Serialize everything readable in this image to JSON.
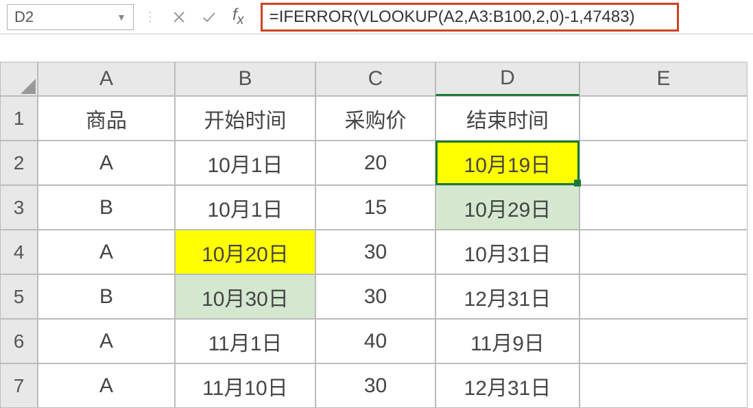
{
  "formula_bar": {
    "cell_reference": "D2",
    "formula": "=IFERROR(VLOOKUP(A2,A3:B100,2,0)-1,47483)"
  },
  "columns": [
    "A",
    "B",
    "C",
    "D",
    "E"
  ],
  "row_numbers": [
    "1",
    "2",
    "3",
    "4",
    "5",
    "6",
    "7"
  ],
  "headers": {
    "A": "商品",
    "B": "开始时间",
    "C": "采购价",
    "D": "结束时间",
    "E": ""
  },
  "rows": [
    {
      "A": "A",
      "B": "10月1日",
      "C": "20",
      "D": "10月19日",
      "E": ""
    },
    {
      "A": "B",
      "B": "10月1日",
      "C": "15",
      "D": "10月29日",
      "E": ""
    },
    {
      "A": "A",
      "B": "10月20日",
      "C": "30",
      "D": "10月31日",
      "E": ""
    },
    {
      "A": "B",
      "B": "10月30日",
      "C": "30",
      "D": "12月31日",
      "E": ""
    },
    {
      "A": "A",
      "B": "11月1日",
      "C": "40",
      "D": "11月9日",
      "E": ""
    },
    {
      "A": "A",
      "B": "11月10日",
      "C": "30",
      "D": "12月31日",
      "E": ""
    }
  ]
}
